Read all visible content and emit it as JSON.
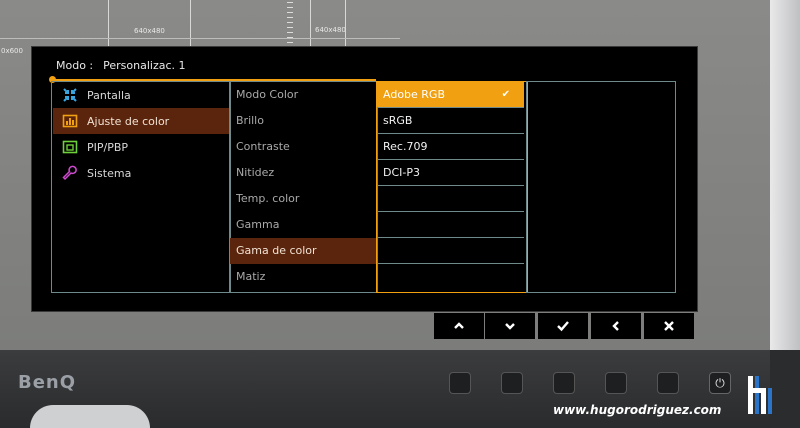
{
  "screen": {
    "resolution_labels": [
      "640x480",
      "640x480",
      "0x600"
    ]
  },
  "osd": {
    "mode_label": "Modo :",
    "mode_value": "Personalizac. 1",
    "main_menu": [
      {
        "label": "Pantalla",
        "icon": "display-adjust-icon",
        "color": "#3aa6e0",
        "active": false
      },
      {
        "label": "Ajuste de color",
        "icon": "color-adjust-icon",
        "color": "#f0a010",
        "active": true
      },
      {
        "label": "PIP/PBP",
        "icon": "pip-icon",
        "color": "#6ed03a",
        "active": false
      },
      {
        "label": "Sistema",
        "icon": "wrench-icon",
        "color": "#d04ad0",
        "active": false
      }
    ],
    "submenu": [
      {
        "label": "Modo Color",
        "active": false
      },
      {
        "label": "Brillo",
        "active": false
      },
      {
        "label": "Contraste",
        "active": false
      },
      {
        "label": "Nitidez",
        "active": false
      },
      {
        "label": "Temp. color",
        "active": false
      },
      {
        "label": "Gamma",
        "active": false
      },
      {
        "label": "Gama de color",
        "active": true
      },
      {
        "label": "Matiz",
        "active": false
      }
    ],
    "options": [
      {
        "label": "Adobe RGB",
        "selected": true,
        "check": "✔"
      },
      {
        "label": "sRGB",
        "selected": false
      },
      {
        "label": "Rec.709",
        "selected": false
      },
      {
        "label": "DCI-P3",
        "selected": false
      }
    ]
  },
  "nav_buttons": [
    {
      "name": "up-icon",
      "glyph": "⌃"
    },
    {
      "name": "down-icon",
      "glyph": "⌄"
    },
    {
      "name": "check-icon",
      "glyph": "✔"
    },
    {
      "name": "back-icon",
      "glyph": "‹"
    },
    {
      "name": "close-icon",
      "glyph": "✖"
    }
  ],
  "bezel": {
    "brand": "BenQ",
    "power_glyph": "⏻"
  },
  "watermark": "www.hugorodriguez.com",
  "colors": {
    "accent": "#f0a010",
    "active_row": "#5a250c",
    "border": "#6e8a8a"
  }
}
